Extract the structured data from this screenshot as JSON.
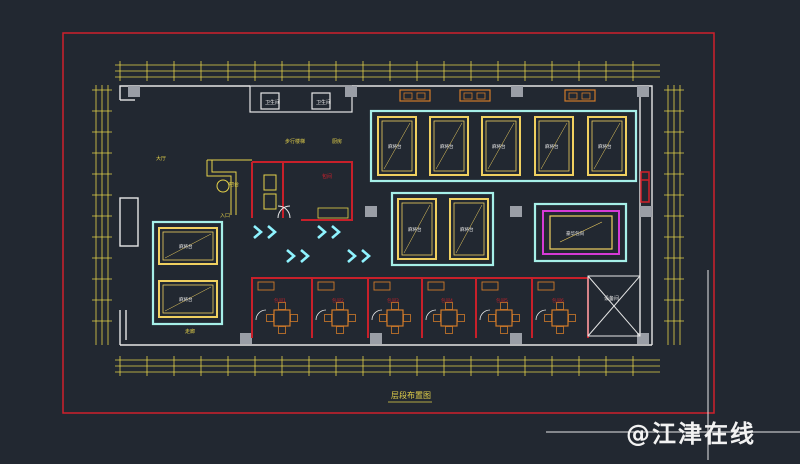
{
  "drawing": {
    "title": "层段布置图",
    "colors": {
      "background": "#222831",
      "frame_red": "#d0202c",
      "wall_white": "#e6e6e6",
      "dimension_yellow": "#e5d24a",
      "highlight_cyan": "#a6efe8",
      "table_yellow": "#f0d060",
      "private_room_red": "#c8202a",
      "arrow_cyan": "#8ff3ff",
      "vip_magenta": "#d63ad6"
    },
    "labels": {
      "top_box_a": "卫生间",
      "top_box_b": "卫生间",
      "stairs": "步行楼梯",
      "front_desk": "吧台",
      "entrance": "入口",
      "lobby": "大厅",
      "corridor_left": "走廊",
      "kitchen": "厨房",
      "room": "包间",
      "vip_room": "豪华包间",
      "mahjong_table": "麻将台",
      "corner_shaft": "设备间"
    }
  },
  "watermark": "@江津在线"
}
